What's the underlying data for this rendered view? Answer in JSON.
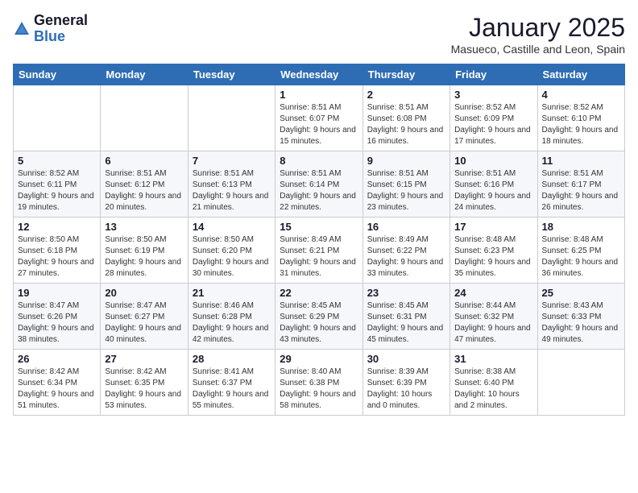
{
  "logo": {
    "general": "General",
    "blue": "Blue"
  },
  "header": {
    "title": "January 2025",
    "subtitle": "Masueco, Castille and Leon, Spain"
  },
  "weekdays": [
    "Sunday",
    "Monday",
    "Tuesday",
    "Wednesday",
    "Thursday",
    "Friday",
    "Saturday"
  ],
  "weeks": [
    [
      {
        "day": "",
        "info": ""
      },
      {
        "day": "",
        "info": ""
      },
      {
        "day": "",
        "info": ""
      },
      {
        "day": "1",
        "info": "Sunrise: 8:51 AM\nSunset: 6:07 PM\nDaylight: 9 hours\nand 15 minutes."
      },
      {
        "day": "2",
        "info": "Sunrise: 8:51 AM\nSunset: 6:08 PM\nDaylight: 9 hours\nand 16 minutes."
      },
      {
        "day": "3",
        "info": "Sunrise: 8:52 AM\nSunset: 6:09 PM\nDaylight: 9 hours\nand 17 minutes."
      },
      {
        "day": "4",
        "info": "Sunrise: 8:52 AM\nSunset: 6:10 PM\nDaylight: 9 hours\nand 18 minutes."
      }
    ],
    [
      {
        "day": "5",
        "info": "Sunrise: 8:52 AM\nSunset: 6:11 PM\nDaylight: 9 hours\nand 19 minutes."
      },
      {
        "day": "6",
        "info": "Sunrise: 8:51 AM\nSunset: 6:12 PM\nDaylight: 9 hours\nand 20 minutes."
      },
      {
        "day": "7",
        "info": "Sunrise: 8:51 AM\nSunset: 6:13 PM\nDaylight: 9 hours\nand 21 minutes."
      },
      {
        "day": "8",
        "info": "Sunrise: 8:51 AM\nSunset: 6:14 PM\nDaylight: 9 hours\nand 22 minutes."
      },
      {
        "day": "9",
        "info": "Sunrise: 8:51 AM\nSunset: 6:15 PM\nDaylight: 9 hours\nand 23 minutes."
      },
      {
        "day": "10",
        "info": "Sunrise: 8:51 AM\nSunset: 6:16 PM\nDaylight: 9 hours\nand 24 minutes."
      },
      {
        "day": "11",
        "info": "Sunrise: 8:51 AM\nSunset: 6:17 PM\nDaylight: 9 hours\nand 26 minutes."
      }
    ],
    [
      {
        "day": "12",
        "info": "Sunrise: 8:50 AM\nSunset: 6:18 PM\nDaylight: 9 hours\nand 27 minutes."
      },
      {
        "day": "13",
        "info": "Sunrise: 8:50 AM\nSunset: 6:19 PM\nDaylight: 9 hours\nand 28 minutes."
      },
      {
        "day": "14",
        "info": "Sunrise: 8:50 AM\nSunset: 6:20 PM\nDaylight: 9 hours\nand 30 minutes."
      },
      {
        "day": "15",
        "info": "Sunrise: 8:49 AM\nSunset: 6:21 PM\nDaylight: 9 hours\nand 31 minutes."
      },
      {
        "day": "16",
        "info": "Sunrise: 8:49 AM\nSunset: 6:22 PM\nDaylight: 9 hours\nand 33 minutes."
      },
      {
        "day": "17",
        "info": "Sunrise: 8:48 AM\nSunset: 6:23 PM\nDaylight: 9 hours\nand 35 minutes."
      },
      {
        "day": "18",
        "info": "Sunrise: 8:48 AM\nSunset: 6:25 PM\nDaylight: 9 hours\nand 36 minutes."
      }
    ],
    [
      {
        "day": "19",
        "info": "Sunrise: 8:47 AM\nSunset: 6:26 PM\nDaylight: 9 hours\nand 38 minutes."
      },
      {
        "day": "20",
        "info": "Sunrise: 8:47 AM\nSunset: 6:27 PM\nDaylight: 9 hours\nand 40 minutes."
      },
      {
        "day": "21",
        "info": "Sunrise: 8:46 AM\nSunset: 6:28 PM\nDaylight: 9 hours\nand 42 minutes."
      },
      {
        "day": "22",
        "info": "Sunrise: 8:45 AM\nSunset: 6:29 PM\nDaylight: 9 hours\nand 43 minutes."
      },
      {
        "day": "23",
        "info": "Sunrise: 8:45 AM\nSunset: 6:31 PM\nDaylight: 9 hours\nand 45 minutes."
      },
      {
        "day": "24",
        "info": "Sunrise: 8:44 AM\nSunset: 6:32 PM\nDaylight: 9 hours\nand 47 minutes."
      },
      {
        "day": "25",
        "info": "Sunrise: 8:43 AM\nSunset: 6:33 PM\nDaylight: 9 hours\nand 49 minutes."
      }
    ],
    [
      {
        "day": "26",
        "info": "Sunrise: 8:42 AM\nSunset: 6:34 PM\nDaylight: 9 hours\nand 51 minutes."
      },
      {
        "day": "27",
        "info": "Sunrise: 8:42 AM\nSunset: 6:35 PM\nDaylight: 9 hours\nand 53 minutes."
      },
      {
        "day": "28",
        "info": "Sunrise: 8:41 AM\nSunset: 6:37 PM\nDaylight: 9 hours\nand 55 minutes."
      },
      {
        "day": "29",
        "info": "Sunrise: 8:40 AM\nSunset: 6:38 PM\nDaylight: 9 hours\nand 58 minutes."
      },
      {
        "day": "30",
        "info": "Sunrise: 8:39 AM\nSunset: 6:39 PM\nDaylight: 10 hours\nand 0 minutes."
      },
      {
        "day": "31",
        "info": "Sunrise: 8:38 AM\nSunset: 6:40 PM\nDaylight: 10 hours\nand 2 minutes."
      },
      {
        "day": "",
        "info": ""
      }
    ]
  ]
}
